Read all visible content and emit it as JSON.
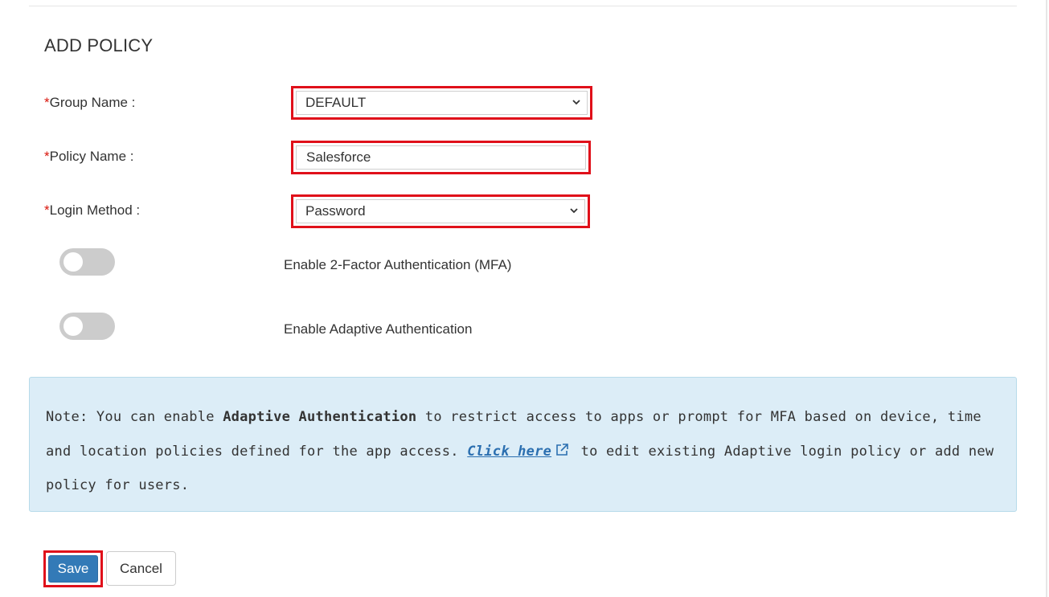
{
  "form": {
    "title": "ADD POLICY",
    "required_marker": "*",
    "group_name": {
      "label": "Group Name :",
      "value": "DEFAULT"
    },
    "policy_name": {
      "label": "Policy Name :",
      "value": "Salesforce"
    },
    "login_method": {
      "label": "Login Method :",
      "value": "Password"
    },
    "toggles": [
      {
        "label": "Enable 2-Factor Authentication (MFA)",
        "enabled": false
      },
      {
        "label": "Enable Adaptive Authentication",
        "enabled": false
      }
    ]
  },
  "note": {
    "prefix": "Note: You can enable ",
    "bold": "Adaptive Authentication",
    "middle": " to restrict access to apps or prompt for MFA based on device, time and location policies defined for the app access. ",
    "link": "Click here",
    "suffix": " to edit existing Adaptive login policy or add new policy for users."
  },
  "buttons": {
    "save": "Save",
    "cancel": "Cancel"
  },
  "colors": {
    "highlight": "#e0101a",
    "primary": "#337ab7",
    "note_bg": "#dcedf7",
    "link": "#2b6fb0",
    "required": "#d9140a"
  },
  "icons": {
    "chevron": "chevron-down-icon",
    "external": "external-link-icon"
  }
}
